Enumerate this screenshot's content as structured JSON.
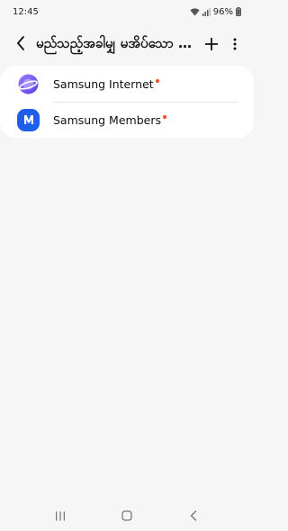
{
  "status_bar": {
    "time": "12:45",
    "battery": "96%"
  },
  "app_bar": {
    "title": "မည်သည့်အခါမျှ မအိပ်သော အက်ပ်များ"
  },
  "apps": [
    {
      "label": "Samsung Internet",
      "icon": "samsung-internet-icon",
      "icon_color": "#7a5cf0",
      "badge_color": "#f4511e"
    },
    {
      "label": "Samsung Members",
      "icon": "samsung-members-icon",
      "icon_color": "#1e5ee8",
      "badge_color": "#f4511e"
    }
  ],
  "colors": {
    "background": "#f6f6f6",
    "card": "#ffffff",
    "badge": "#f4511e"
  }
}
